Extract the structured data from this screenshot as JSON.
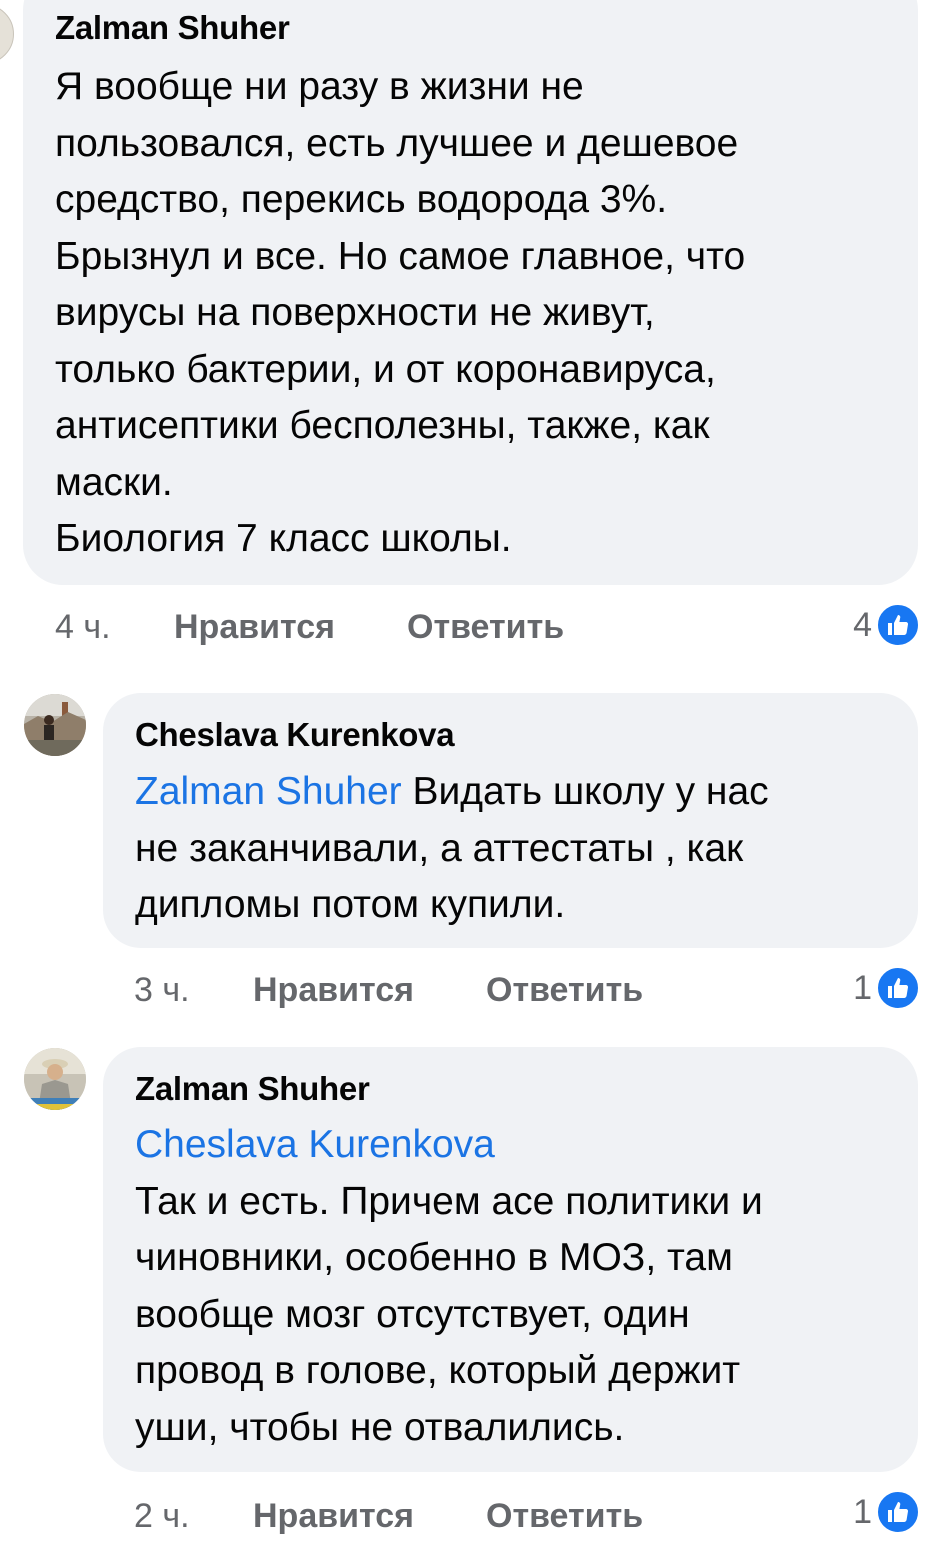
{
  "comments": [
    {
      "author": "Zalman Shuher",
      "mention": "",
      "text_lines": [
        "Я вообще ни разу в жизни не",
        "пользовался, есть лучшее и дешевое",
        "средство, перекись водорода 3%.",
        "Брызнул и все. Но самое главное, что",
        "вирусы на поверхности не живут,",
        "только бактерии, и от коронавируса,",
        "антисептики бесполезны, также, как",
        "маски.",
        "Биология 7 класс школы."
      ],
      "time": "4 ч.",
      "like_label": "Нравится",
      "reply_label": "Ответить",
      "reaction_count": "4",
      "reaction_icon": "like-icon"
    },
    {
      "author": "Cheslava Kurenkova",
      "mention": "Zalman Shuher",
      "text_lines": [
        " Видать школу у нас",
        "не заканчивали, а аттестаты , как",
        "дипломы потом купили."
      ],
      "time": "3 ч.",
      "like_label": "Нравится",
      "reply_label": "Ответить",
      "reaction_count": "1",
      "reaction_icon": "like-icon"
    },
    {
      "author": "Zalman Shuher",
      "mention": "Cheslava Kurenkova",
      "text_lines": [
        "Так и есть. Причем асе политики и",
        "чиновники, особенно в МОЗ, там",
        "вообще мозг отсутствует, один",
        "провод в голове, который держит",
        "уши, чтобы не отвалились."
      ],
      "time": "2 ч.",
      "like_label": "Нравится",
      "reply_label": "Ответить",
      "reaction_count": "1",
      "reaction_icon": "like-icon"
    }
  ],
  "colors": {
    "bubble": "#f0f2f5",
    "mention": "#1b74e4",
    "like_badge": "#1877f2",
    "meta": "#65676b"
  }
}
